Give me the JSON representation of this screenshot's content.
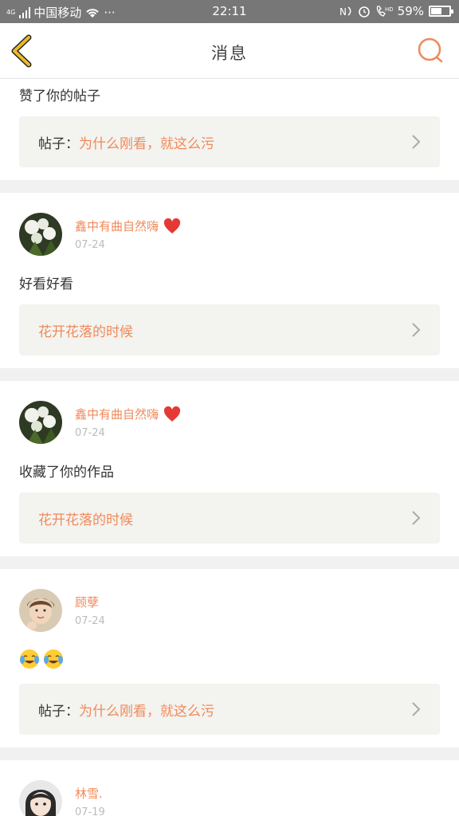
{
  "status_bar": {
    "network": "4G",
    "carrier": "中国移动",
    "more": "···",
    "time": "22:11",
    "battery": "59%",
    "battery_level": 0.59
  },
  "header": {
    "title": "消息"
  },
  "notifications": [
    {
      "message": "赞了你的帖子",
      "card_prefix": "帖子：",
      "card_title": "为什么刚看，就这么污"
    },
    {
      "username": "鑫中有曲自然嗨",
      "date": "07-24",
      "message": "好看好看",
      "card_prefix": "",
      "card_title": "花开花落的时候"
    },
    {
      "username": "鑫中有曲自然嗨",
      "date": "07-24",
      "message": "收藏了你的作品",
      "card_prefix": "",
      "card_title": "花开花落的时候"
    },
    {
      "username": "顾孽",
      "date": "07-24",
      "message_emojis": [
        "tears-of-joy-emoji",
        "tears-of-joy-emoji"
      ],
      "card_prefix": "帖子：",
      "card_title": "为什么刚看，就这么污"
    },
    {
      "username": "林雪.",
      "date": "07-19"
    }
  ],
  "colors": {
    "accent": "#f08a5b",
    "back_arrow": "#e9b92a",
    "card_bg": "#f3f3ef",
    "divider": "#f1f1f1"
  }
}
